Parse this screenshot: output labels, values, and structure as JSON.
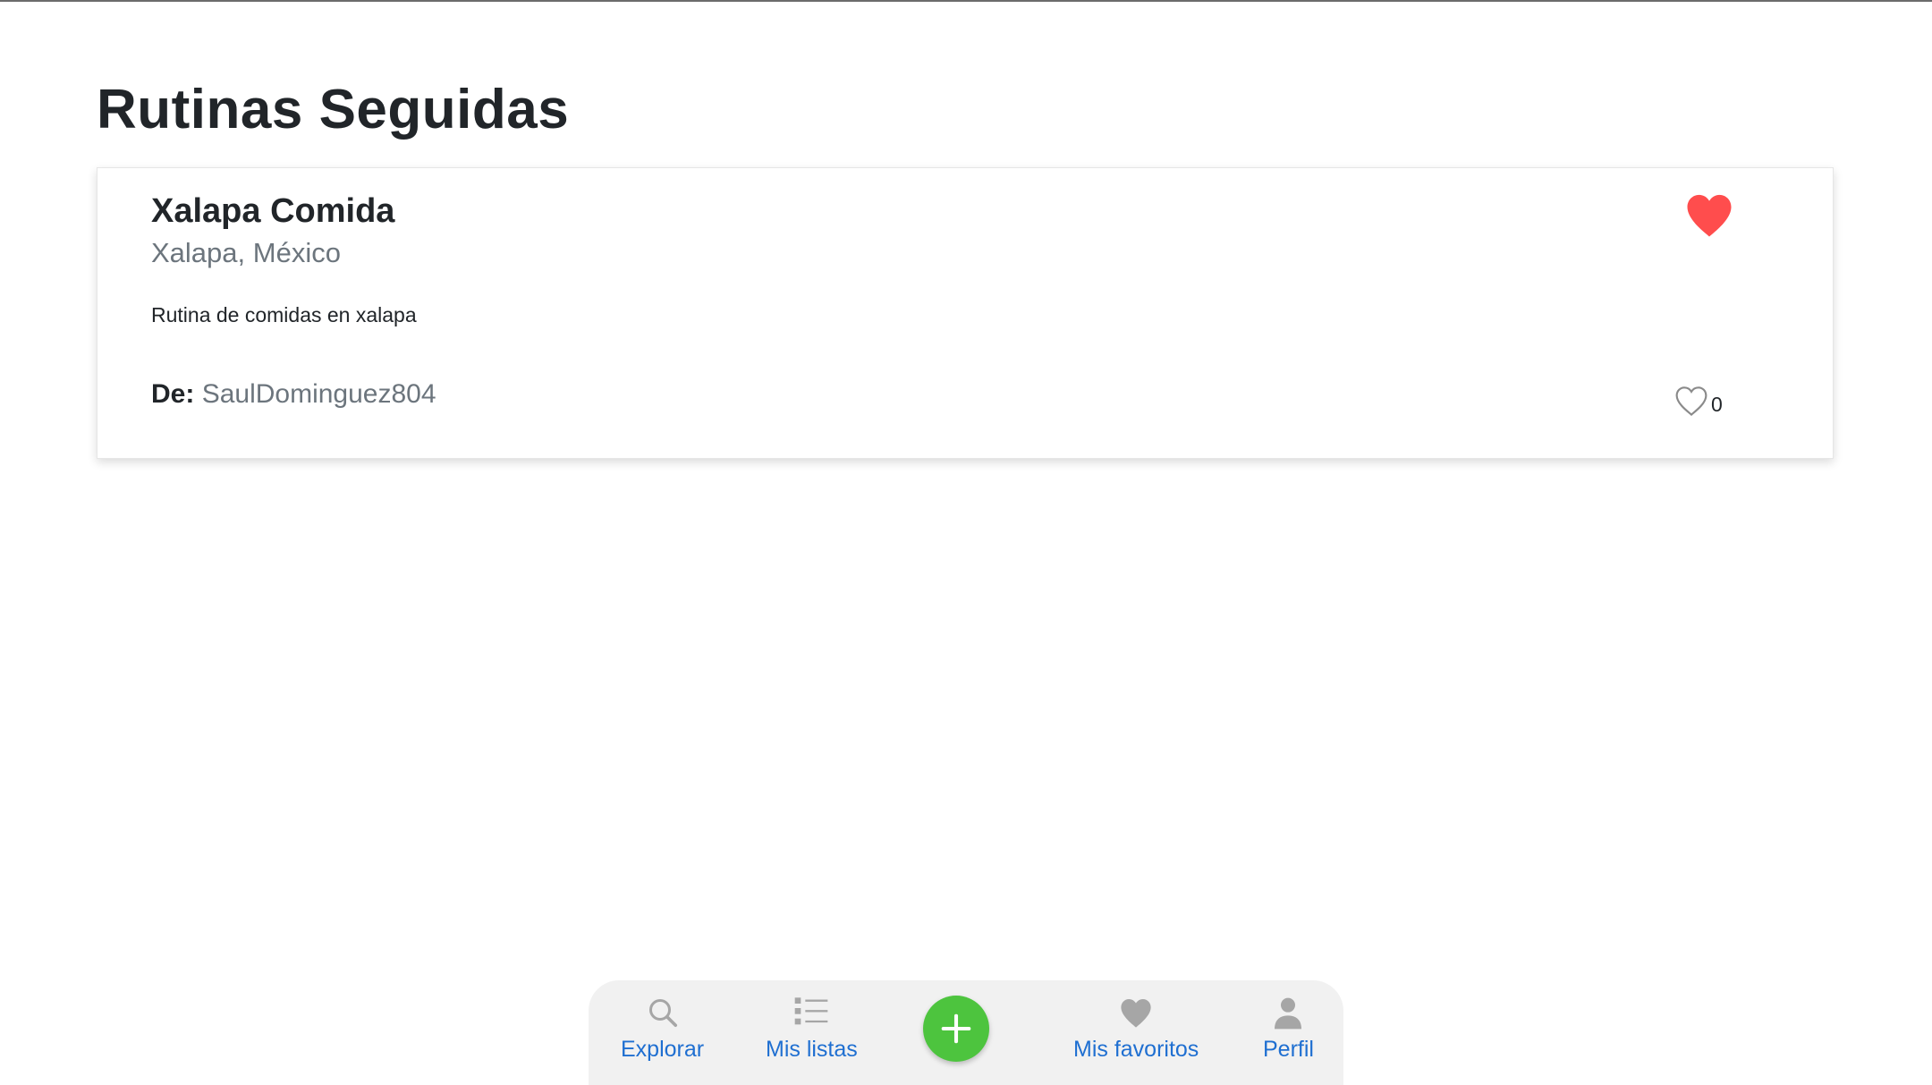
{
  "page": {
    "title": "Rutinas Seguidas"
  },
  "card": {
    "title": "Xalapa Comida",
    "location": "Xalapa, México",
    "description": "Rutina de comidas en xalapa",
    "author_label": "De:",
    "author": "SaulDominguez804",
    "likes_count": "0",
    "favorite_icon": "heart-filled-icon",
    "likes_icon": "heart-outline-icon"
  },
  "nav": {
    "explore": {
      "label": "Explorar",
      "icon": "search-icon"
    },
    "lists": {
      "label": "Mis listas",
      "icon": "list-icon"
    },
    "add": {
      "icon": "plus-icon"
    },
    "favorites": {
      "label": "Mis favoritos",
      "icon": "heart-icon"
    },
    "profile": {
      "label": "Perfil",
      "icon": "user-icon"
    }
  },
  "colors": {
    "accent_blue": "#1f6fd1",
    "favorite_red": "#ff4d4d",
    "add_green": "#4dc43e",
    "nav_icon_gray": "#a6a6a6"
  }
}
